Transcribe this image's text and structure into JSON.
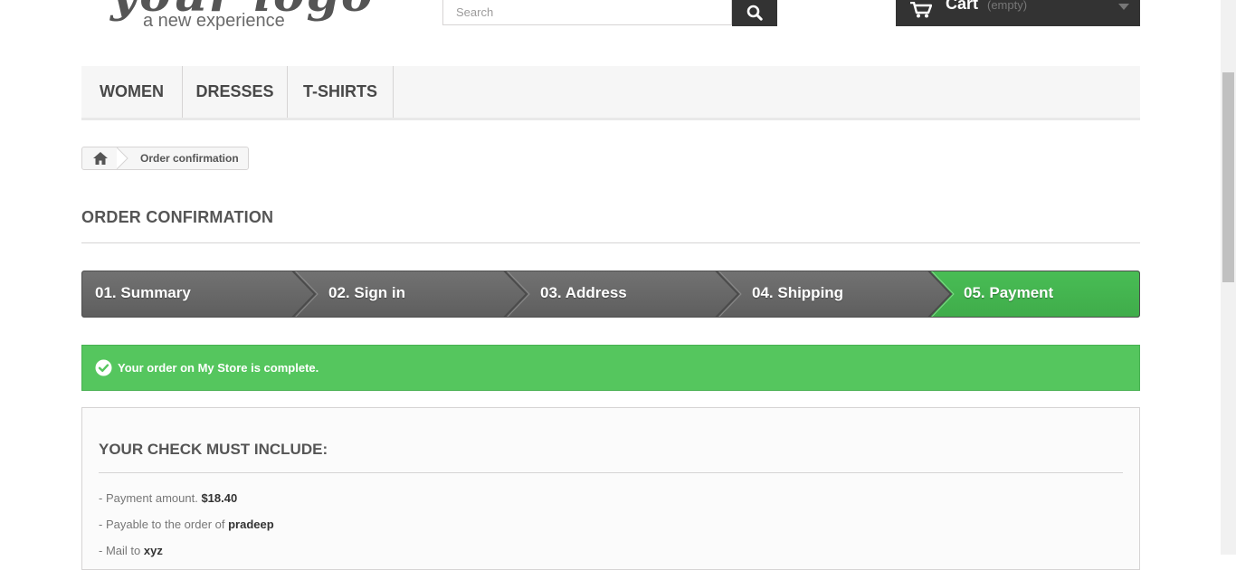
{
  "header": {
    "logo_script": "your logo",
    "logo_tagline": "a new experience",
    "search_placeholder": "Search",
    "cart_label": "Cart",
    "cart_status": "(empty)"
  },
  "menu": {
    "items": [
      {
        "label": "WOMEN"
      },
      {
        "label": "DRESSES"
      },
      {
        "label": "T-SHIRTS"
      }
    ]
  },
  "breadcrumb": {
    "current": "Order confirmation"
  },
  "page_title": "ORDER CONFIRMATION",
  "steps": [
    {
      "label": "01. Summary",
      "state": "done"
    },
    {
      "label": "02. Sign in",
      "state": "done"
    },
    {
      "label": "03. Address",
      "state": "done"
    },
    {
      "label": "04. Shipping",
      "state": "done"
    },
    {
      "label": "05. Payment",
      "state": "current"
    }
  ],
  "alert": {
    "text": "Your order on My Store is complete."
  },
  "check_box": {
    "title": "YOUR CHECK MUST INCLUDE:",
    "lines": [
      {
        "prefix": "- Payment amount.",
        "value": "$18.40"
      },
      {
        "prefix": "- Payable to the order of",
        "value": "pradeep"
      },
      {
        "prefix": "- Mail to",
        "value": "xyz"
      }
    ]
  },
  "colors": {
    "step_done": "#6a6a6a",
    "step_current": "#45b550",
    "alert_bg": "#55c65e",
    "dark": "#333333"
  },
  "icons": {
    "search": "search-icon",
    "cart": "cart-icon",
    "caret": "caret-down-icon",
    "home": "home-icon",
    "check": "check-circle-icon"
  }
}
